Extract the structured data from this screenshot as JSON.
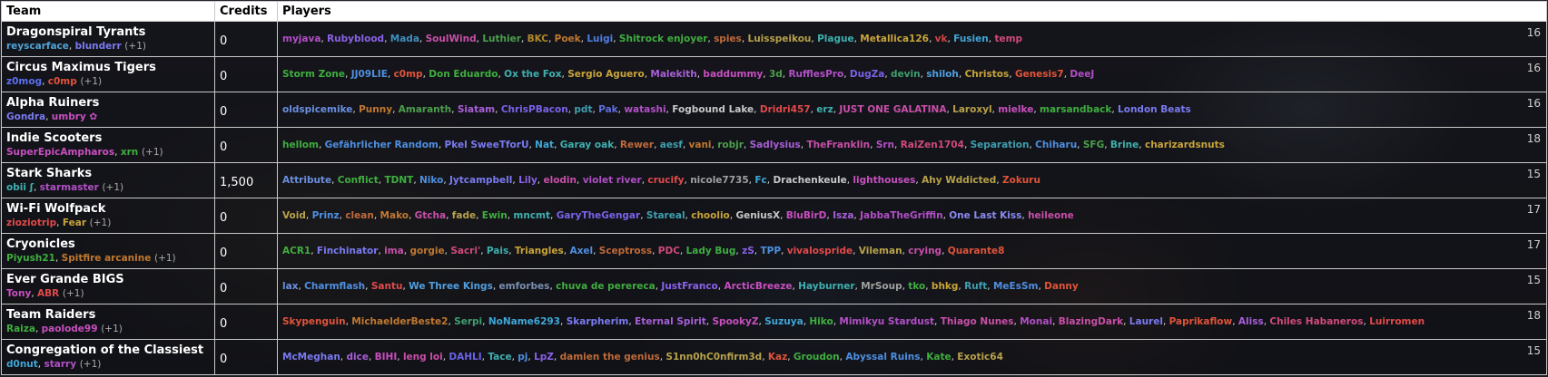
{
  "headers": {
    "team": "Team",
    "credits": "Credits",
    "players": "Players"
  },
  "teams": [
    {
      "name": "Dragonspiral Tyrants",
      "managers": [
        {
          "name": "reyscarface",
          "color": "#4fa3d6"
        },
        {
          "name": "blunderr",
          "color": "#7a7af0"
        }
      ],
      "extra": "(+1)",
      "credits": "0",
      "count": "16",
      "players": [
        {
          "name": "myjava",
          "color": "#b24fc7"
        },
        {
          "name": "Rubyblood",
          "color": "#8a62e8"
        },
        {
          "name": "Mada",
          "color": "#3f8fbf"
        },
        {
          "name": "SoulWind",
          "color": "#c84fa8"
        },
        {
          "name": "Luthier",
          "color": "#4c9f4c"
        },
        {
          "name": "BKC",
          "color": "#b08a2a"
        },
        {
          "name": "Poek",
          "color": "#c07830"
        },
        {
          "name": "Luigi",
          "color": "#4f7fe0"
        },
        {
          "name": "Shitrock enjoyer",
          "color": "#3fae3f"
        },
        {
          "name": "spies",
          "color": "#c06a3a"
        },
        {
          "name": "Luisspeikou",
          "color": "#b8a24a"
        },
        {
          "name": "Plague",
          "color": "#3fb0b0"
        },
        {
          "name": "Metallica126",
          "color": "#c8a43a"
        },
        {
          "name": "vk",
          "color": "#d04646"
        },
        {
          "name": "Fusien",
          "color": "#3fa7d8"
        },
        {
          "name": "temp",
          "color": "#d04a7a"
        }
      ]
    },
    {
      "name": "Circus Maximus Tigers",
      "managers": [
        {
          "name": "z0mog",
          "color": "#5a6ff0"
        },
        {
          "name": "c0mp",
          "color": "#e0543a"
        }
      ],
      "extra": "(+1)",
      "credits": "0",
      "count": "16",
      "players": [
        {
          "name": "Storm Zone",
          "color": "#3fae3f"
        },
        {
          "name": "JJ09LIE",
          "color": "#4f8fe0"
        },
        {
          "name": "c0mp",
          "color": "#e0543a"
        },
        {
          "name": "Don Eduardo",
          "color": "#3fae3f"
        },
        {
          "name": "Ox the Fox",
          "color": "#3fb0b0"
        },
        {
          "name": "Sergio Aguero",
          "color": "#c8a43a"
        },
        {
          "name": "Malekith",
          "color": "#a85fd8"
        },
        {
          "name": "baddummy",
          "color": "#c84fc0"
        },
        {
          "name": "3d",
          "color": "#4c9f4c"
        },
        {
          "name": "RufflesPro",
          "color": "#b24fc7"
        },
        {
          "name": "DugZa",
          "color": "#7a62e8"
        },
        {
          "name": "devin",
          "color": "#3f9f6f"
        },
        {
          "name": "shiloh",
          "color": "#4f9fe0"
        },
        {
          "name": "Christos",
          "color": "#c8a43a"
        },
        {
          "name": "Genesis7",
          "color": "#e0543a"
        },
        {
          "name": "DeeJ",
          "color": "#b24fc7"
        }
      ]
    },
    {
      "name": "Alpha Ruiners",
      "managers": [
        {
          "name": "Gondra",
          "color": "#7a7af0"
        },
        {
          "name": "umbry ✿",
          "color": "#c84fc0"
        }
      ],
      "extra": "",
      "credits": "0",
      "count": "16",
      "players": [
        {
          "name": "oldspicemike",
          "color": "#6a8fe0"
        },
        {
          "name": "Punny",
          "color": "#c07830"
        },
        {
          "name": "Amaranth",
          "color": "#4c9f4c"
        },
        {
          "name": "Siatam",
          "color": "#a85fd8"
        },
        {
          "name": "ChrisPBacon",
          "color": "#7a62e8"
        },
        {
          "name": "pdt",
          "color": "#3f9fb0"
        },
        {
          "name": "Pak",
          "color": "#5f6fe0"
        },
        {
          "name": "watashi",
          "color": "#b24fc7"
        },
        {
          "name": "Fogbound Lake",
          "color": "#c8c8c8"
        },
        {
          "name": "Dridri457",
          "color": "#e04a4a"
        },
        {
          "name": "erz",
          "color": "#3fb0b0"
        },
        {
          "name": "JUST ONE GALATINA",
          "color": "#c84fa8"
        },
        {
          "name": "Laroxyl",
          "color": "#b8a24a"
        },
        {
          "name": "mielke",
          "color": "#c84fc0"
        },
        {
          "name": "marsandback",
          "color": "#3fae3f"
        },
        {
          "name": "London Beats",
          "color": "#7a7af0"
        }
      ]
    },
    {
      "name": "Indie Scooters",
      "managers": [
        {
          "name": "SuperEpicAmpharos",
          "color": "#c84fc0"
        },
        {
          "name": "xrn",
          "color": "#3fae3f"
        }
      ],
      "extra": "(+1)",
      "credits": "0",
      "count": "18",
      "players": [
        {
          "name": "hellom",
          "color": "#3fae3f"
        },
        {
          "name": "Gefährlicher Random",
          "color": "#4f8fe0"
        },
        {
          "name": "Pkel SweeTforU",
          "color": "#7a7af0"
        },
        {
          "name": "Nat",
          "color": "#3fa7d8"
        },
        {
          "name": "Garay oak",
          "color": "#3fb0b0"
        },
        {
          "name": "Rewer",
          "color": "#c06a3a"
        },
        {
          "name": "aesf",
          "color": "#3f9fb0"
        },
        {
          "name": "vani",
          "color": "#c07830"
        },
        {
          "name": "robjr",
          "color": "#4c9f4c"
        },
        {
          "name": "Sadlysius",
          "color": "#a85fd8"
        },
        {
          "name": "TheFranklin",
          "color": "#c84fa8"
        },
        {
          "name": "Srn",
          "color": "#b24fc7"
        },
        {
          "name": "RaiZen1704",
          "color": "#d04a7a"
        },
        {
          "name": "Separation",
          "color": "#3f9fb0"
        },
        {
          "name": "Chiharu",
          "color": "#4f8fe0"
        },
        {
          "name": "SFG",
          "color": "#4c9f4c"
        },
        {
          "name": "Brine",
          "color": "#3fb0b0"
        },
        {
          "name": "charizardsnuts",
          "color": "#c8a43a"
        }
      ]
    },
    {
      "name": "Stark Sharks",
      "managers": [
        {
          "name": "obii ʃ",
          "color": "#3fb0b0"
        },
        {
          "name": "starmaster",
          "color": "#b24fc7"
        }
      ],
      "extra": "(+1)",
      "credits": "1,500",
      "count": "15",
      "players": [
        {
          "name": "Attribute",
          "color": "#6a8fe0"
        },
        {
          "name": "Conflict",
          "color": "#3fae3f"
        },
        {
          "name": "TDNT",
          "color": "#3fae3f"
        },
        {
          "name": "Niko",
          "color": "#4f8fe0"
        },
        {
          "name": "Jytcampbell",
          "color": "#7a7af0"
        },
        {
          "name": "Lily",
          "color": "#8a62e8"
        },
        {
          "name": "elodin",
          "color": "#c84fa8"
        },
        {
          "name": "violet river",
          "color": "#b24fc7"
        },
        {
          "name": "crucify",
          "color": "#e04a4a"
        },
        {
          "name": "nicole7735",
          "color": "#a0a0a0"
        },
        {
          "name": "Fc",
          "color": "#3fa7d8"
        },
        {
          "name": "Drachenkeule",
          "color": "#c8c8c8"
        },
        {
          "name": "lighthouses",
          "color": "#c84fc0"
        },
        {
          "name": "Ahy Wddicted",
          "color": "#b8a24a"
        },
        {
          "name": "Zokuru",
          "color": "#e0543a"
        }
      ]
    },
    {
      "name": "Wi-Fi Wolfpack",
      "managers": [
        {
          "name": "zioziotrip",
          "color": "#e04a4a"
        },
        {
          "name": "Fear",
          "color": "#c8a43a"
        }
      ],
      "extra": "(+1)",
      "credits": "0",
      "count": "17",
      "players": [
        {
          "name": "Void",
          "color": "#b8a24a"
        },
        {
          "name": "Prinz",
          "color": "#4f8fe0"
        },
        {
          "name": "clean",
          "color": "#c06a3a"
        },
        {
          "name": "Mako",
          "color": "#c07830"
        },
        {
          "name": "Gtcha",
          "color": "#c84fa8"
        },
        {
          "name": "fade",
          "color": "#b8a24a"
        },
        {
          "name": "Ewin",
          "color": "#3fae3f"
        },
        {
          "name": "mncmt",
          "color": "#3fb0b0"
        },
        {
          "name": "GaryTheGengar",
          "color": "#7a62e8"
        },
        {
          "name": "Stareal",
          "color": "#3f9fb0"
        },
        {
          "name": "choolio",
          "color": "#c8a43a"
        },
        {
          "name": "GeniusX",
          "color": "#c8c8c8"
        },
        {
          "name": "BluBirD",
          "color": "#c84fc0"
        },
        {
          "name": "Isza",
          "color": "#a85fd8"
        },
        {
          "name": "JabbaTheGriffin",
          "color": "#b24fc7"
        },
        {
          "name": "One Last Kiss",
          "color": "#8a8af0"
        },
        {
          "name": "heileone",
          "color": "#c84fa8"
        }
      ]
    },
    {
      "name": "Cryonicles",
      "managers": [
        {
          "name": "Piyush21",
          "color": "#3fae3f"
        },
        {
          "name": "Spitfire arcanine",
          "color": "#c07830"
        }
      ],
      "extra": "(+1)",
      "credits": "0",
      "count": "17",
      "players": [
        {
          "name": "ACR1",
          "color": "#3fae3f"
        },
        {
          "name": "Finchinator",
          "color": "#7a7af0"
        },
        {
          "name": "ima",
          "color": "#c84fa8"
        },
        {
          "name": "gorgie",
          "color": "#c07830"
        },
        {
          "name": "Sacri'",
          "color": "#d04a7a"
        },
        {
          "name": "Pais",
          "color": "#3fb0b0"
        },
        {
          "name": "Triangles",
          "color": "#c8a43a"
        },
        {
          "name": "Axel",
          "color": "#4f8fe0"
        },
        {
          "name": "Sceptross",
          "color": "#c06a3a"
        },
        {
          "name": "PDC",
          "color": "#d04a7a"
        },
        {
          "name": "Lady Bug",
          "color": "#3fae3f"
        },
        {
          "name": "zS",
          "color": "#8a62e8"
        },
        {
          "name": "TPP",
          "color": "#4f8fe0"
        },
        {
          "name": "vivalospride",
          "color": "#e04a4a"
        },
        {
          "name": "Vileman",
          "color": "#b8a24a"
        },
        {
          "name": "crying",
          "color": "#c84fa8"
        },
        {
          "name": "Quarante8",
          "color": "#e0543a"
        }
      ]
    },
    {
      "name": "Ever Grande BIGS",
      "managers": [
        {
          "name": "Tony",
          "color": "#c84fc0"
        },
        {
          "name": "ABR",
          "color": "#e04a4a"
        }
      ],
      "extra": "(+1)",
      "credits": "0",
      "count": "15",
      "players": [
        {
          "name": "lax",
          "color": "#6a8fe0"
        },
        {
          "name": "Charmflash",
          "color": "#4f8fe0"
        },
        {
          "name": "Santu",
          "color": "#e04a4a"
        },
        {
          "name": "We Three Kings",
          "color": "#4f9fe0"
        },
        {
          "name": "emforbes",
          "color": "#7a8fb0"
        },
        {
          "name": "chuva de perereca",
          "color": "#3fae3f"
        },
        {
          "name": "JustFranco",
          "color": "#8a62e8"
        },
        {
          "name": "ArcticBreeze",
          "color": "#c84fc0"
        },
        {
          "name": "Hayburner",
          "color": "#3fb0b0"
        },
        {
          "name": "MrSoup",
          "color": "#a0a0a0"
        },
        {
          "name": "tko",
          "color": "#3fae3f"
        },
        {
          "name": "bhkg",
          "color": "#c8a43a"
        },
        {
          "name": "Ruft",
          "color": "#3f9fb0"
        },
        {
          "name": "MeEsSm",
          "color": "#4f8fe0"
        },
        {
          "name": "Danny",
          "color": "#e0543a"
        }
      ]
    },
    {
      "name": "Team Raiders",
      "managers": [
        {
          "name": "Raiza",
          "color": "#3fae3f"
        },
        {
          "name": "paolode99",
          "color": "#c84fc0"
        }
      ],
      "extra": "(+1)",
      "credits": "0",
      "count": "18",
      "players": [
        {
          "name": "Skypenguin",
          "color": "#e0543a"
        },
        {
          "name": "MichaelderBeste2",
          "color": "#c07830"
        },
        {
          "name": "Serpi",
          "color": "#3f9f6f"
        },
        {
          "name": "NoName6293",
          "color": "#3fa7d8"
        },
        {
          "name": "Skarpherim",
          "color": "#7a7af0"
        },
        {
          "name": "Eternal Spirit",
          "color": "#a85fd8"
        },
        {
          "name": "SpookyZ",
          "color": "#c84fc0"
        },
        {
          "name": "Suzuya",
          "color": "#3fa7d8"
        },
        {
          "name": "Hiko",
          "color": "#3fae3f"
        },
        {
          "name": "Mimikyu Stardust",
          "color": "#b24fc7"
        },
        {
          "name": "Thiago Nunes",
          "color": "#c84fa8"
        },
        {
          "name": "Monai",
          "color": "#b24fc7"
        },
        {
          "name": "BlazingDark",
          "color": "#c84fa8"
        },
        {
          "name": "Laurel",
          "color": "#7a7af0"
        },
        {
          "name": "Paprikaflow",
          "color": "#e0543a"
        },
        {
          "name": "Aliss",
          "color": "#a85fd8"
        },
        {
          "name": "Chiles Habaneros",
          "color": "#d04a7a"
        },
        {
          "name": "Luirromen",
          "color": "#e04a4a"
        }
      ]
    },
    {
      "name": "Congregation of the Classiest",
      "managers": [
        {
          "name": "d0nut",
          "color": "#3fa7d8"
        },
        {
          "name": "starry",
          "color": "#b24fc7"
        }
      ],
      "extra": "(+1)",
      "credits": "0",
      "count": "15",
      "players": [
        {
          "name": "McMeghan",
          "color": "#7a7af0"
        },
        {
          "name": "dice",
          "color": "#a85fd8"
        },
        {
          "name": "BIHI",
          "color": "#c84fc0"
        },
        {
          "name": "leng loi",
          "color": "#c84fa8"
        },
        {
          "name": "DAHLI",
          "color": "#6a62e8"
        },
        {
          "name": "Tace",
          "color": "#3fb0b0"
        },
        {
          "name": "pj",
          "color": "#4f8fe0"
        },
        {
          "name": "LpZ",
          "color": "#8a62e8"
        },
        {
          "name": "damien the genius",
          "color": "#c06a3a"
        },
        {
          "name": "S1nn0hC0nfirm3d",
          "color": "#b8a24a"
        },
        {
          "name": "Kaz",
          "color": "#e0543a"
        },
        {
          "name": "Groudon",
          "color": "#3fae3f"
        },
        {
          "name": "Abyssal Ruins",
          "color": "#4f8fe0"
        },
        {
          "name": "Kate",
          "color": "#3fae3f"
        },
        {
          "name": "Exotic64",
          "color": "#b8a24a"
        }
      ]
    }
  ]
}
